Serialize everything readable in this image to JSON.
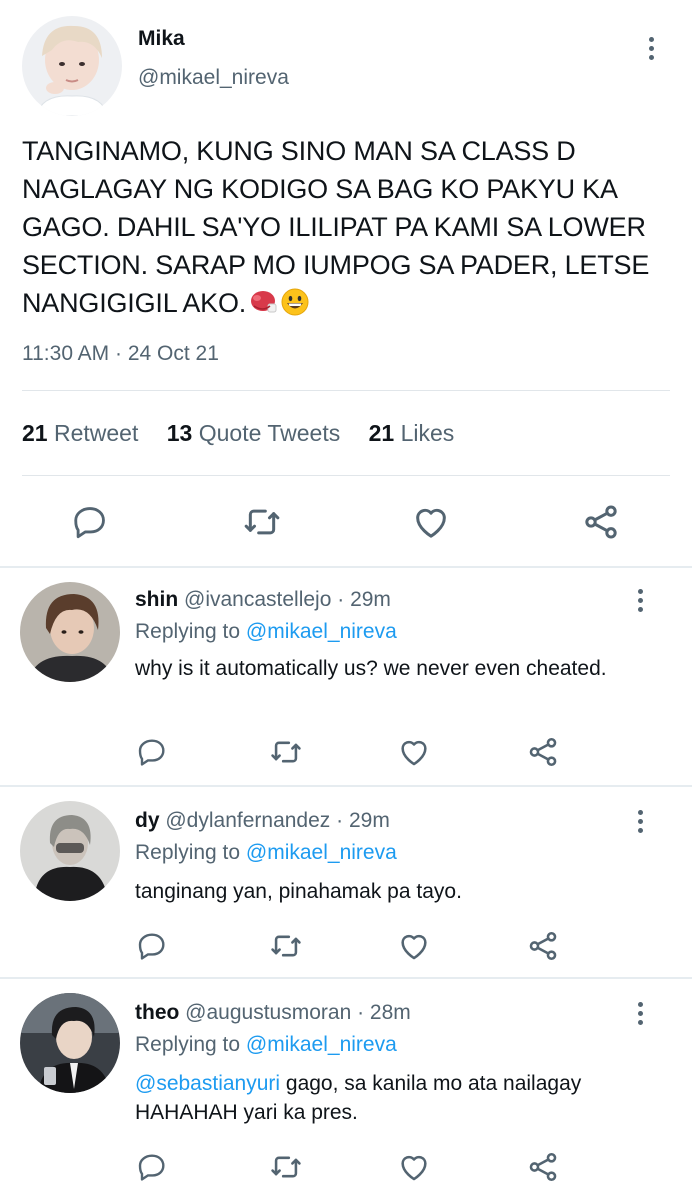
{
  "tweet": {
    "author": {
      "name": "Mika",
      "handle": "@mikael_nireva"
    },
    "text": "TANGINAMO, KUNG SINO MAN SA CLASS D NAGLAGAY NG KODIGO SA BAG KO PAKYU KA GAGO. DAHIL SA'YO ILILIPAT PA KAMI SA LOWER SECTION. SARAP MO IUMPOG SA PADER, LETSE NANGIGIGIL AKO.",
    "emojis": [
      "boxing-glove-icon",
      "grinning-face-icon"
    ],
    "timestamp": "11:30 AM · 24 Oct 21",
    "stats": {
      "retweets_count": "21",
      "retweets_label": "Retweet",
      "quotes_count": "13",
      "quotes_label": "Quote Tweets",
      "likes_count": "21",
      "likes_label": "Likes"
    },
    "actions": [
      "reply-icon",
      "retweet-icon",
      "like-icon",
      "share-icon"
    ]
  },
  "replies": [
    {
      "name": "shin",
      "handle": "@ivancastellejo",
      "time": "· 29m",
      "replying_label": "Replying to",
      "replying_to": "@mikael_nireva",
      "mention": "",
      "text": "why is it automatically us? we never even cheated."
    },
    {
      "name": "dy",
      "handle": "@dylanfernandez",
      "time": "· 29m",
      "replying_label": "Replying to",
      "replying_to": "@mikael_nireva",
      "mention": "",
      "text": "tanginang yan, pinahamak pa tayo."
    },
    {
      "name": "theo",
      "handle": "@augustusmoran",
      "time": "· 28m",
      "replying_label": "Replying to",
      "replying_to": "@mikael_nireva",
      "mention": "@sebastianyuri",
      "text": " gago, sa kanila mo ata nailagay HAHAHAH yari ka pres."
    }
  ],
  "colors": {
    "link": "#1d9bf0",
    "secondary_text": "#536471",
    "primary_text": "#0f1419",
    "divider": "#e6ecf0"
  }
}
